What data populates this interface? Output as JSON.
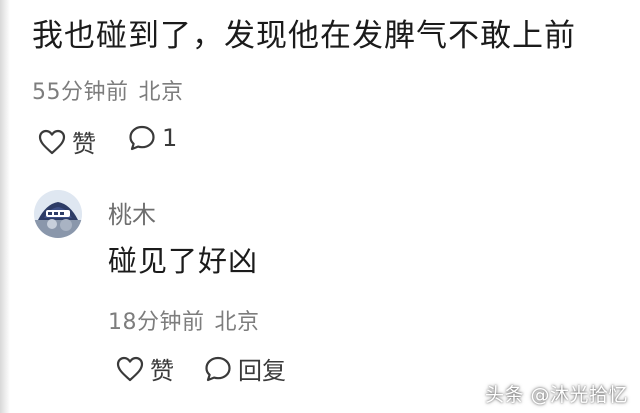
{
  "comment": {
    "text": "我也碰到了，发现他在发脾气不敢上前",
    "time": "55分钟前",
    "location": "北京",
    "like_icon": "heart-outline-icon",
    "like_label": "赞",
    "reply_icon": "speech-bubble-icon",
    "reply_count": "1"
  },
  "reply": {
    "avatar_icon": "avatar-image",
    "username": "桃木",
    "text": "碰见了好凶",
    "time": "18分钟前",
    "location": "北京",
    "like_icon": "heart-outline-icon",
    "like_label": "赞",
    "reply_icon": "speech-bubble-icon",
    "reply_label": "回复"
  },
  "watermark": {
    "text": "头条 @沐光拾忆"
  },
  "colors": {
    "primary_text": "#1b1b1b",
    "meta_text": "#7d7d7d",
    "icon_stroke": "#3a3a3a"
  }
}
